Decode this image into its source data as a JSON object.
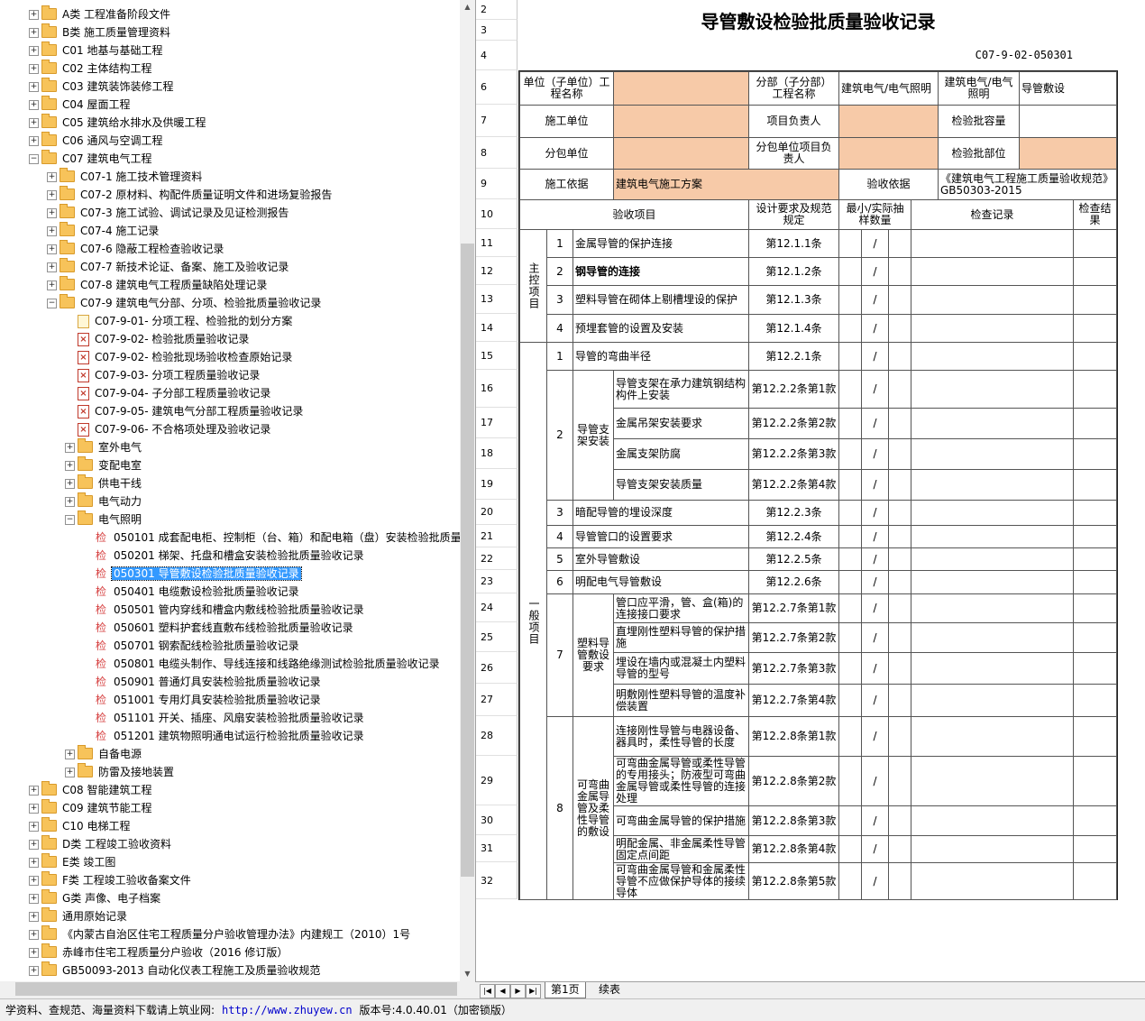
{
  "tree": {
    "nodes": [
      {
        "level": 2,
        "exp": "+",
        "icon": "folder",
        "label": "A类 工程准备阶段文件"
      },
      {
        "level": 2,
        "exp": "+",
        "icon": "folder",
        "label": "B类 施工质量管理资料"
      },
      {
        "level": 2,
        "exp": "+",
        "icon": "folder",
        "label": "C01 地基与基础工程"
      },
      {
        "level": 2,
        "exp": "+",
        "icon": "folder",
        "label": "C02 主体结构工程"
      },
      {
        "level": 2,
        "exp": "+",
        "icon": "folder",
        "label": "C03 建筑装饰装修工程"
      },
      {
        "level": 2,
        "exp": "+",
        "icon": "folder",
        "label": "C04 屋面工程"
      },
      {
        "level": 2,
        "exp": "+",
        "icon": "folder",
        "label": "C05 建筑给水排水及供暖工程"
      },
      {
        "level": 2,
        "exp": "+",
        "icon": "folder",
        "label": "C06 通风与空调工程"
      },
      {
        "level": 2,
        "exp": "-",
        "icon": "folder",
        "label": "C07 建筑电气工程"
      },
      {
        "level": 3,
        "exp": "+",
        "icon": "folder",
        "label": "C07-1 施工技术管理资料"
      },
      {
        "level": 3,
        "exp": "+",
        "icon": "folder",
        "label": "C07-2 原材料、构配件质量证明文件和进场复验报告"
      },
      {
        "level": 3,
        "exp": "+",
        "icon": "folder",
        "label": "C07-3 施工试验、调试记录及见证检测报告"
      },
      {
        "level": 3,
        "exp": "+",
        "icon": "folder",
        "label": "C07-4 施工记录"
      },
      {
        "level": 3,
        "exp": "+",
        "icon": "folder",
        "label": "C07-6 隐蔽工程检查验收记录"
      },
      {
        "level": 3,
        "exp": "+",
        "icon": "folder",
        "label": "C07-7 新技术论证、备案、施工及验收记录"
      },
      {
        "level": 3,
        "exp": "+",
        "icon": "folder",
        "label": "C07-8 建筑电气工程质量缺陷处理记录"
      },
      {
        "level": 3,
        "exp": "-",
        "icon": "folder",
        "label": "C07-9 建筑电气分部、分项、检验批质量验收记录"
      },
      {
        "level": 4,
        "exp": "",
        "icon": "doc",
        "label": "C07-9-01- 分项工程、检验批的划分方案"
      },
      {
        "level": 4,
        "exp": "",
        "icon": "pdf",
        "label": "C07-9-02- 检验批质量验收记录"
      },
      {
        "level": 4,
        "exp": "",
        "icon": "pdf",
        "label": "C07-9-02- 检验批现场验收检查原始记录"
      },
      {
        "level": 4,
        "exp": "",
        "icon": "pdf",
        "label": "C07-9-03- 分项工程质量验收记录"
      },
      {
        "level": 4,
        "exp": "",
        "icon": "pdf",
        "label": "C07-9-04- 子分部工程质量验收记录"
      },
      {
        "level": 4,
        "exp": "",
        "icon": "pdf",
        "label": "C07-9-05- 建筑电气分部工程质量验收记录"
      },
      {
        "level": 4,
        "exp": "",
        "icon": "pdf",
        "label": "C07-9-06- 不合格项处理及验收记录"
      },
      {
        "level": 4,
        "exp": "+",
        "icon": "folder",
        "label": "室外电气"
      },
      {
        "level": 4,
        "exp": "+",
        "icon": "folder",
        "label": "变配电室"
      },
      {
        "level": 4,
        "exp": "+",
        "icon": "folder",
        "label": "供电干线"
      },
      {
        "level": 4,
        "exp": "+",
        "icon": "folder",
        "label": "电气动力"
      },
      {
        "level": 4,
        "exp": "-",
        "icon": "folder",
        "label": "电气照明"
      },
      {
        "level": 5,
        "exp": "",
        "icon": "jian",
        "label": "050101 成套配电柜、控制柜（台、箱）和配电箱（盘）安装检验批质量验"
      },
      {
        "level": 5,
        "exp": "",
        "icon": "jian",
        "label": "050201 梯架、托盘和槽盒安装检验批质量验收记录"
      },
      {
        "level": 5,
        "exp": "",
        "icon": "jian",
        "label": "050301 导管敷设检验批质量验收记录",
        "selected": true
      },
      {
        "level": 5,
        "exp": "",
        "icon": "jian",
        "label": "050401 电缆敷设检验批质量验收记录"
      },
      {
        "level": 5,
        "exp": "",
        "icon": "jian",
        "label": "050501 管内穿线和槽盒内敷线检验批质量验收记录"
      },
      {
        "level": 5,
        "exp": "",
        "icon": "jian",
        "label": "050601 塑料护套线直敷布线检验批质量验收记录"
      },
      {
        "level": 5,
        "exp": "",
        "icon": "jian",
        "label": "050701 钢索配线检验批质量验收记录"
      },
      {
        "level": 5,
        "exp": "",
        "icon": "jian",
        "label": "050801 电缆头制作、导线连接和线路绝缘测试检验批质量验收记录"
      },
      {
        "level": 5,
        "exp": "",
        "icon": "jian",
        "label": "050901 普通灯具安装检验批质量验收记录"
      },
      {
        "level": 5,
        "exp": "",
        "icon": "jian",
        "label": "051001 专用灯具安装检验批质量验收记录"
      },
      {
        "level": 5,
        "exp": "",
        "icon": "jian",
        "label": "051101 开关、插座、风扇安装检验批质量验收记录"
      },
      {
        "level": 5,
        "exp": "",
        "icon": "jian",
        "label": "051201 建筑物照明通电试运行检验批质量验收记录"
      },
      {
        "level": 4,
        "exp": "+",
        "icon": "folder",
        "label": "自备电源"
      },
      {
        "level": 4,
        "exp": "+",
        "icon": "folder",
        "label": "防雷及接地装置"
      },
      {
        "level": 2,
        "exp": "+",
        "icon": "folder",
        "label": "C08 智能建筑工程"
      },
      {
        "level": 2,
        "exp": "+",
        "icon": "folder",
        "label": "C09 建筑节能工程"
      },
      {
        "level": 2,
        "exp": "+",
        "icon": "folder",
        "label": "C10 电梯工程"
      },
      {
        "level": 2,
        "exp": "+",
        "icon": "folder",
        "label": "D类 工程竣工验收资料"
      },
      {
        "level": 2,
        "exp": "+",
        "icon": "folder",
        "label": "E类 竣工图"
      },
      {
        "level": 2,
        "exp": "+",
        "icon": "folder",
        "label": "F类 工程竣工验收备案文件"
      },
      {
        "level": 2,
        "exp": "+",
        "icon": "folder",
        "label": "G类 声像、电子档案"
      },
      {
        "level": 2,
        "exp": "+",
        "icon": "folder",
        "label": "通用原始记录"
      },
      {
        "level": 2,
        "exp": "+",
        "icon": "folder",
        "label": "《内蒙古自治区住宅工程质量分户验收管理办法》内建规工（2010）1号"
      },
      {
        "level": 2,
        "exp": "+",
        "icon": "folder",
        "label": "赤峰市住宅工程质量分户验收（2016 修订版）"
      },
      {
        "level": 2,
        "exp": "+",
        "icon": "folder",
        "label": "GB50093-2013 自动化仪表工程施工及质量验收规范"
      }
    ]
  },
  "sheet": {
    "title": "导管敷设检验批质量验收记录",
    "code": "C07-9-02-050301",
    "row_numbers": [
      "2",
      "3",
      "4",
      "6",
      "7",
      "8",
      "9",
      "10",
      "11",
      "12",
      "13",
      "14",
      "15",
      "16",
      "17",
      "18",
      "19",
      "20",
      "21",
      "22",
      "23",
      "24",
      "25",
      "26",
      "27",
      "28",
      "29",
      "30",
      "31",
      "32"
    ],
    "labels": {
      "unit": "单位（子单位）工程名称",
      "division": "分部（子分部）工程名称",
      "division_val": "建筑电气/电气照明",
      "sub_item": "建筑电气/电气照明",
      "sub_item_val": "导管敷设",
      "constructor": "施工单位",
      "pm": "项目负责人",
      "batch_cap": "检验批容量",
      "subcontractor": "分包单位",
      "sub_pm": "分包单位项目负责人",
      "batch_loc": "检验批部位",
      "basis": "施工依据",
      "basis_val": "建筑电气施工方案",
      "acc_basis": "验收依据",
      "acc_basis_val": "《建筑电气工程施工质量验收规范》GB50303-2015",
      "h_item": "验收项目",
      "h_design": "设计要求及规范规定",
      "h_sample": "最小/实际抽样数量",
      "h_record": "检查记录",
      "h_result": "检查结果",
      "main": "主控项目",
      "general": "一般项目",
      "slash": "/"
    },
    "main_items": [
      {
        "no": "1",
        "text": "金属导管的保护连接",
        "clause": "第12.1.1条"
      },
      {
        "no": "2",
        "text": "钢导管的连接",
        "clause": "第12.1.2条",
        "bold": true
      },
      {
        "no": "3",
        "text": "塑料导管在砌体上剔槽埋设的保护",
        "clause": "第12.1.3条"
      },
      {
        "no": "4",
        "text": "预埋套管的设置及安装",
        "clause": "第12.1.4条"
      }
    ],
    "general_simple": [
      {
        "no": "1",
        "text": "导管的弯曲半径",
        "clause": "第12.2.1条"
      },
      {
        "no": "3",
        "text": "暗配导管的埋设深度",
        "clause": "第12.2.3条"
      },
      {
        "no": "4",
        "text": "导管管口的设置要求",
        "clause": "第12.2.4条"
      },
      {
        "no": "5",
        "text": "室外导管敷设",
        "clause": "第12.2.5条"
      },
      {
        "no": "6",
        "text": "明配电气导管敷设",
        "clause": "第12.2.6条"
      }
    ],
    "group2": {
      "no": "2",
      "name": "导管支架安装",
      "subs": [
        {
          "text": "导管支架在承力建筑钢结构构件上安装",
          "clause": "第12.2.2条第1款"
        },
        {
          "text": "金属吊架安装要求",
          "clause": "第12.2.2条第2款"
        },
        {
          "text": "金属支架防腐",
          "clause": "第12.2.2条第3款"
        },
        {
          "text": "导管支架安装质量",
          "clause": "第12.2.2条第4款"
        }
      ]
    },
    "group7": {
      "no": "7",
      "name": "塑料导管敷设要求",
      "subs": [
        {
          "text": "管口应平滑，管、盒(箱)的连接接口要求",
          "clause": "第12.2.7条第1款"
        },
        {
          "text": "直埋刚性塑料导管的保护措施",
          "clause": "第12.2.7条第2款"
        },
        {
          "text": "埋设在墙内或混凝土内塑料导管的型号",
          "clause": "第12.2.7条第3款"
        },
        {
          "text": "明敷刚性塑料导管的温度补偿装置",
          "clause": "第12.2.7条第4款"
        }
      ]
    },
    "group8": {
      "no": "8",
      "name": "可弯曲金属导管及柔性导管的敷设",
      "subs": [
        {
          "text": "连接刚性导管与电器设备、器具时，柔性导管的长度",
          "clause": "第12.2.8条第1款"
        },
        {
          "text": "可弯曲金属导管或柔性导管的专用接头；防液型可弯曲金属导管或柔性导管的连接处理",
          "clause": "第12.2.8条第2款"
        },
        {
          "text": "可弯曲金属导管的保护措施",
          "clause": "第12.2.8条第3款"
        },
        {
          "text": "明配金属、非金属柔性导管固定点间距",
          "clause": "第12.2.8条第4款"
        },
        {
          "text": "可弯曲金属导管和金属柔性导管不应做保护导体的接续导体",
          "clause": "第12.2.8条第5款"
        }
      ]
    }
  },
  "tabs": {
    "first": "第1页",
    "second": "续表"
  },
  "status": {
    "prefix": "学资料、查规范、海量资料下载请上筑业网:",
    "url": "http://www.zhuyew.cn",
    "version": "版本号:4.0.40.01（加密锁版）"
  },
  "colors": {
    "peach": "#f7caa8",
    "select": "#3399ff",
    "link": "#0000cc"
  }
}
